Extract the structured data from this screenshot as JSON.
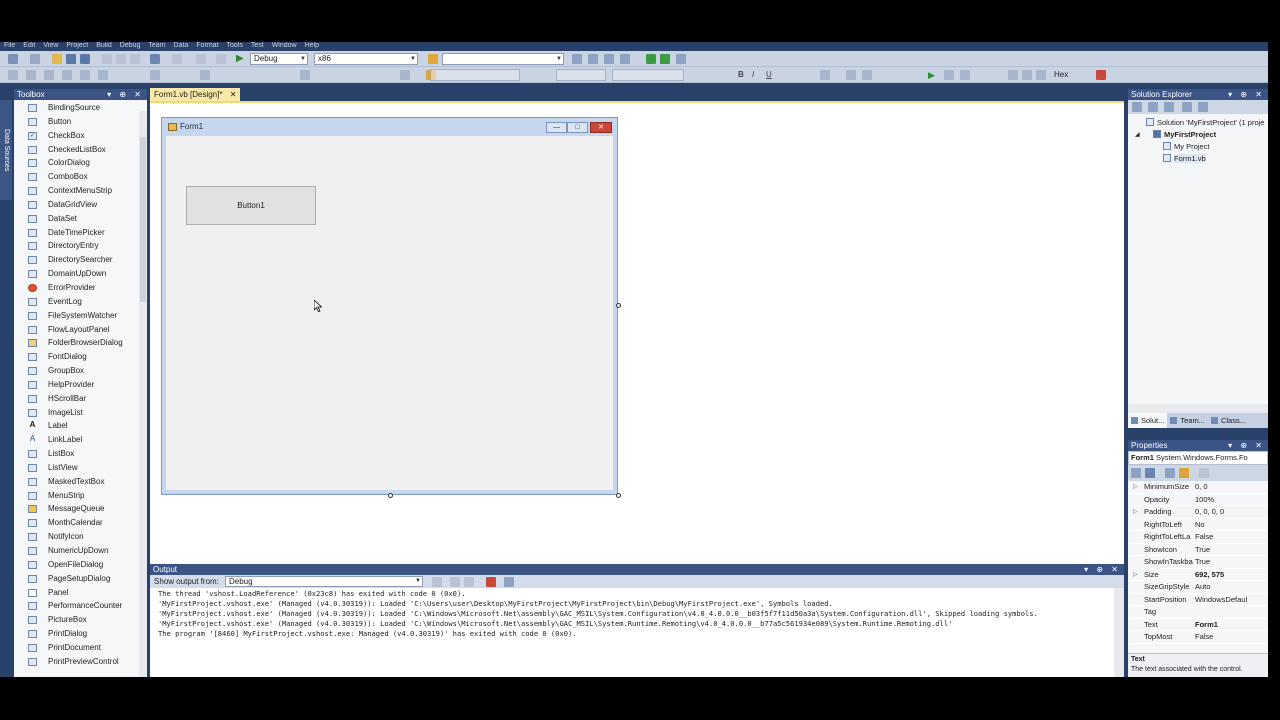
{
  "menu": [
    "File",
    "Edit",
    "View",
    "Project",
    "Build",
    "Debug",
    "Team",
    "Data",
    "Format",
    "Tools",
    "Test",
    "Window",
    "Help"
  ],
  "toolbar": {
    "config": "Debug",
    "platform": "x86",
    "hex_label": "Hex",
    "bold": "B",
    "italic": "I",
    "underline": "U"
  },
  "toolbox": {
    "title": "Toolbox",
    "side_tab": "Data Sources",
    "items": [
      "BindingSource",
      "Button",
      "CheckBox",
      "CheckedListBox",
      "ColorDialog",
      "ComboBox",
      "ContextMenuStrip",
      "DataGridView",
      "DataSet",
      "DateTimePicker",
      "DirectoryEntry",
      "DirectorySearcher",
      "DomainUpDown",
      "ErrorProvider",
      "EventLog",
      "FileSystemWatcher",
      "FlowLayoutPanel",
      "FolderBrowserDialog",
      "FontDialog",
      "GroupBox",
      "HelpProvider",
      "HScrollBar",
      "ImageList",
      "Label",
      "LinkLabel",
      "ListBox",
      "ListView",
      "MaskedTextBox",
      "MenuStrip",
      "MessageQueue",
      "MonthCalendar",
      "NotifyIcon",
      "NumericUpDown",
      "OpenFileDialog",
      "PageSetupDialog",
      "Panel",
      "PerformanceCounter",
      "PictureBox",
      "PrintDialog",
      "PrintDocument",
      "PrintPreviewControl"
    ]
  },
  "document": {
    "tab": "Form1.vb [Design]*",
    "form_title": "Form1",
    "button_text": "Button1"
  },
  "output": {
    "title": "Output",
    "show_from_label": "Show output from:",
    "show_from_value": "Debug",
    "lines": [
      "The thread 'vshost.LoadReference' (0x23c8) has exited with code 0 (0x0).",
      "'MyFirstProject.vshost.exe' (Managed (v4.0.30319)): Loaded 'C:\\Users\\user\\Desktop\\MyFirstProject\\MyFirstProject\\bin\\Debug\\MyFirstProject.exe', Symbols loaded.",
      "'MyFirstProject.vshost.exe' (Managed (v4.0.30319)): Loaded 'C:\\Windows\\Microsoft.Net\\assembly\\GAC_MSIL\\System.Configuration\\v4.0_4.0.0.0__b03f5f7f11d50a3a\\System.Configuration.dll', Skipped loading symbols.",
      "'MyFirstProject.vshost.exe' (Managed (v4.0.30319)): Loaded 'C:\\Windows\\Microsoft.Net\\assembly\\GAC_MSIL\\System.Runtime.Remoting\\v4.0_4.0.0.0__b77a5c561934e089\\System.Runtime.Remoting.dll'",
      "The program '[8460] MyFirstProject.vshost.exe: Managed (v4.0.30319)' has exited with code 0 (0x0)."
    ]
  },
  "solution_explorer": {
    "title": "Solution Explorer",
    "solution": "Solution 'MyFirstProject' (1 proje",
    "project": "MyFirstProject",
    "my_project": "My Project",
    "form_file": "Form1.vb",
    "tabs": [
      "Solut...",
      "Team...",
      "Class..."
    ]
  },
  "properties": {
    "title": "Properties",
    "selected_name": "Form1",
    "selected_type": "System.Windows.Forms.Fo",
    "rows": [
      {
        "name": "MinimumSize",
        "value": "0, 0",
        "expand": true
      },
      {
        "name": "Opacity",
        "value": "100%"
      },
      {
        "name": "Padding",
        "value": "0, 0, 0, 0",
        "expand": true
      },
      {
        "name": "RightToLeft",
        "value": "No"
      },
      {
        "name": "RightToLeftLa",
        "value": "False"
      },
      {
        "name": "ShowIcon",
        "value": "True"
      },
      {
        "name": "ShowInTaskba",
        "value": "True"
      },
      {
        "name": "Size",
        "value": "692, 575",
        "expand": true,
        "bold": true
      },
      {
        "name": "SizeGripStyle",
        "value": "Auto"
      },
      {
        "name": "StartPosition",
        "value": "WindowsDefaul"
      },
      {
        "name": "Tag",
        "value": ""
      },
      {
        "name": "Text",
        "value": "Form1",
        "bold": true
      },
      {
        "name": "TopMost",
        "value": "False"
      }
    ],
    "desc_title": "Text",
    "desc_text": "The text associated with the control."
  }
}
